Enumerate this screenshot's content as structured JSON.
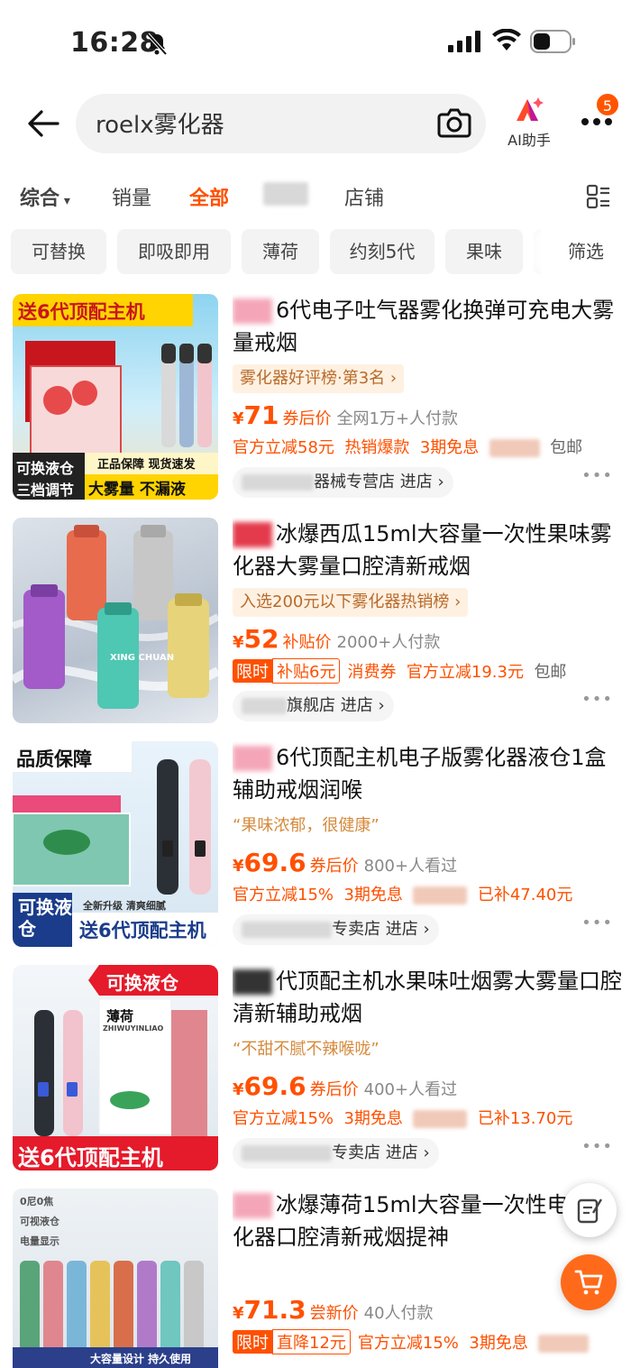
{
  "status": {
    "time": "16:28"
  },
  "search": {
    "query": "roelx雾化器",
    "ai_label": "AI助手",
    "badge": "5"
  },
  "sort": {
    "items": [
      "综合",
      "销量",
      "全部",
      "店铺"
    ]
  },
  "chips": [
    "可替换",
    "即吸即用",
    "薄荷",
    "约刻5代",
    "果味"
  ],
  "filter_label": "筛选",
  "products": [
    {
      "title": "6代电子吐气器雾化换弹可充电大雾量戒烟",
      "badge": "雾化器好评榜·第3名 ›",
      "price": "71",
      "price_label": "券后价",
      "sales": "全网1万+人付款",
      "tags": [
        "官方立减58元",
        "热销爆款",
        "3期免息"
      ],
      "tag_tail": "包邮",
      "shop": "器械专营店 进店 ›",
      "img_text": [
        "送6代顶配主机",
        "可换液仓",
        "三档调节",
        "正品保障 现货速发",
        "大雾量 不漏液"
      ]
    },
    {
      "title": "冰爆西瓜15ml大容量一次性果味雾化器大雾量口腔清新戒烟",
      "badge": "入选200元以下雾化器热销榜 ›",
      "price": "52",
      "price_label": "补贴价",
      "sales": "2000+人付款",
      "limit": "限时",
      "limit_sub": "补贴6元",
      "tags": [
        "消费券",
        "官方立减19.3元"
      ],
      "tag_tail": "包邮",
      "shop": "旗舰店 进店 ›",
      "img_text": [
        "XING CHUAN"
      ]
    },
    {
      "title": "6代顶配主机电子版雾化器液仓1盒辅助戒烟润喉",
      "quote": "“果味浓郁，很健康”",
      "price": "69.6",
      "price_label": "券后价",
      "sales": "800+人看过",
      "tags": [
        "官方立减15%",
        "3期免息"
      ],
      "tag_tail": "已补47.40元",
      "shop": "专卖店 进店 ›",
      "img_text": [
        "品质保障",
        "可换液仓",
        "送6代顶配主机",
        "全新升级 清爽细腻"
      ]
    },
    {
      "title": "代顶配主机水果味吐烟雾大雾量口腔清新辅助戒烟",
      "quote": "“不甜不腻不辣喉咙”",
      "price": "69.6",
      "price_label": "券后价",
      "sales": "400+人看过",
      "tags": [
        "官方立减15%",
        "3期免息"
      ],
      "tag_tail": "已补13.70元",
      "shop": "专卖店 进店 ›",
      "img_text": [
        "可换液仓",
        "送6代顶配主机",
        "薄荷",
        "ZHIWUYINLIAO"
      ]
    },
    {
      "title": "冰爆薄荷15ml大容量一次性电子雾化器口腔清新戒烟提神",
      "price": "71.3",
      "price_label": "尝新价",
      "sales": "40人付款",
      "limit": "限时",
      "limit_sub": "直降12元",
      "tags": [
        "官方立减15%",
        "3期免息"
      ],
      "shop": "",
      "img_text": [
        "0尼0焦",
        "可视液仓",
        "电量显示",
        "大容量设计 持久使用"
      ]
    }
  ],
  "colors": {
    "accent": "#ff5000",
    "chip_bg": "#f3f3f3"
  }
}
